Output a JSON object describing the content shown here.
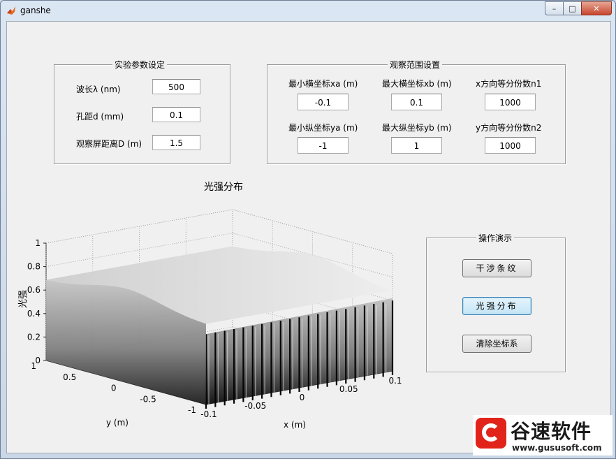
{
  "window": {
    "title": "ganshe",
    "icon": "matlab-icon",
    "minimize": "–",
    "maximize": "□",
    "close": "✕"
  },
  "exp_params": {
    "title": "实验参数设定",
    "wavelength_label": "波长λ (nm)",
    "wavelength_value": "500",
    "slit_label": "孔距d (mm)",
    "slit_value": "0.1",
    "screen_label": "观察屏距离D (m)",
    "screen_value": "1.5"
  },
  "range": {
    "title": "观察范围设置",
    "xa_label": "最小横坐标xa (m)",
    "xa_value": "-0.1",
    "xb_label": "最大横坐标xb (m)",
    "xb_value": "0.1",
    "n1_label": "x方向等分份数n1",
    "n1_value": "1000",
    "ya_label": "最小纵坐标ya (m)",
    "ya_value": "-1",
    "yb_label": "最大纵坐标yb (m)",
    "yb_value": "1",
    "n2_label": "y方向等分份数n2",
    "n2_value": "1000"
  },
  "ops": {
    "title": "操作演示",
    "fringe_button": "干涉条纹",
    "intensity_button": "光强分布",
    "clear_button": "清除坐标系"
  },
  "chart_data": {
    "type": "surface",
    "title": "光强分布",
    "xlabel": "x (m)",
    "ylabel": "y (m)",
    "zlabel": "光强",
    "xlim": [
      -0.1,
      0.1
    ],
    "ylim": [
      -1,
      1
    ],
    "zlim": [
      0,
      1
    ],
    "x_ticks": [
      "-0.1",
      "-0.05",
      "0",
      "0.05",
      "0.1"
    ],
    "y_ticks": [
      "-1",
      "-0.5",
      "0",
      "0.5",
      "1"
    ],
    "z_ticks": [
      "0",
      "0.2",
      "0.4",
      "0.6",
      "0.8",
      "1"
    ],
    "fringe_count": 20,
    "peak_intensity": 1,
    "colormap": "gray"
  },
  "watermark": {
    "name": "谷速软件",
    "url": "www.gususoft.com"
  }
}
